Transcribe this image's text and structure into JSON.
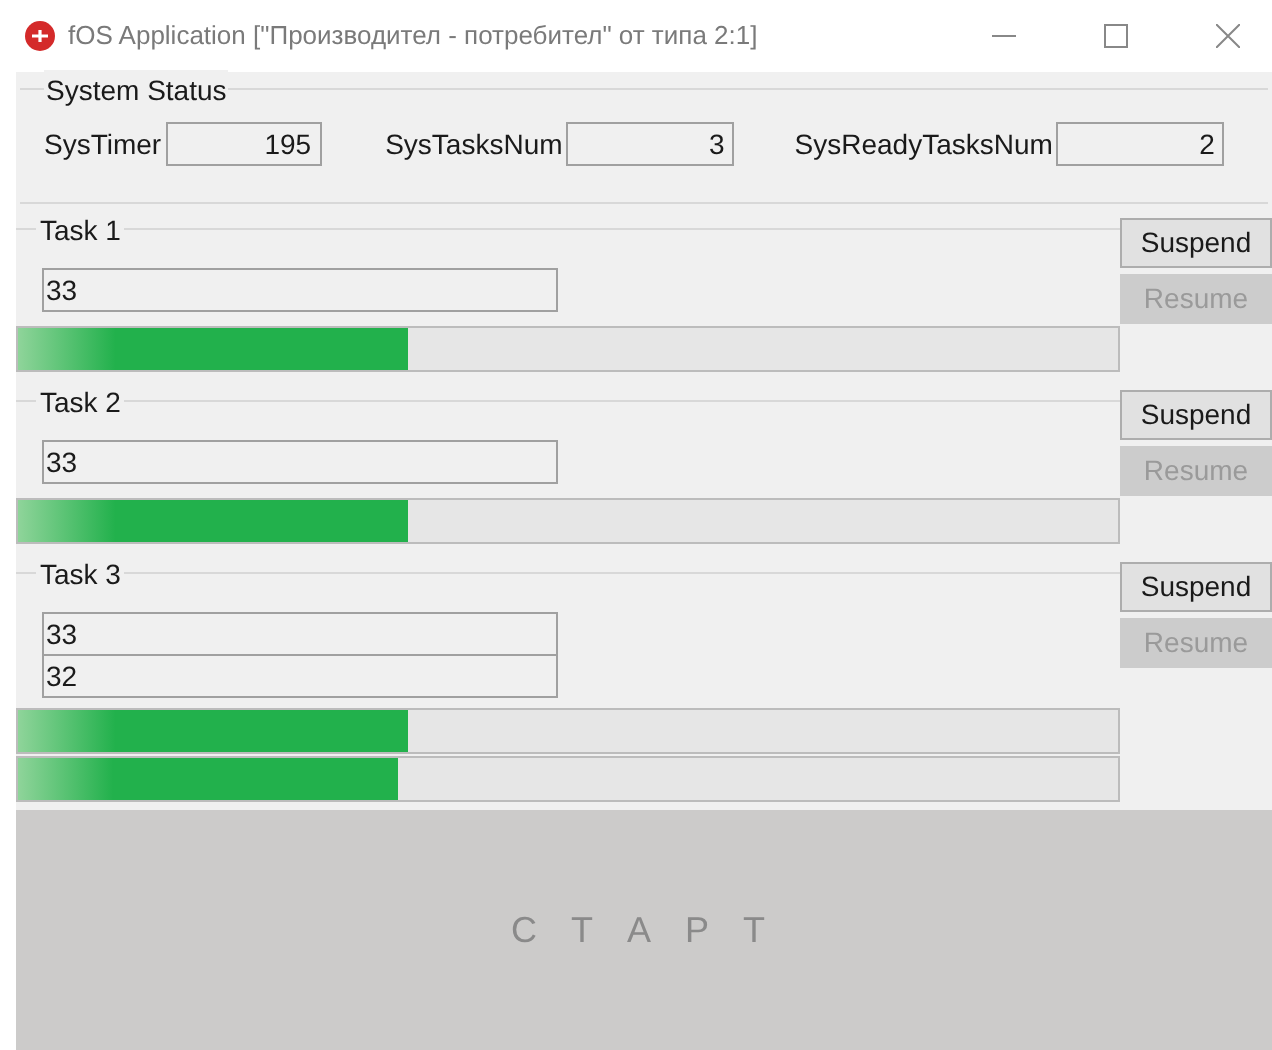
{
  "window": {
    "title": "fOS Application [\"Производител - потребител\" от типа 2:1]"
  },
  "system_status": {
    "title": "System Status",
    "fields": [
      {
        "label": "SysTimer",
        "value": "195"
      },
      {
        "label": "SysTasksNum",
        "value": "3"
      },
      {
        "label": "SysReadyTasksNum",
        "value": "2"
      }
    ]
  },
  "tasks": [
    {
      "title": "Task 1",
      "values": [
        "33"
      ],
      "bars": [
        {
          "level": 0.355
        }
      ],
      "suspend": {
        "label": "Suspend",
        "disabled": false
      },
      "resume": {
        "label": "Resume",
        "disabled": true
      }
    },
    {
      "title": "Task 2",
      "values": [
        "33"
      ],
      "bars": [
        {
          "level": 0.355
        }
      ],
      "suspend": {
        "label": "Suspend",
        "disabled": false
      },
      "resume": {
        "label": "Resume",
        "disabled": true
      }
    },
    {
      "title": "Task 3",
      "values": [
        "33",
        "32"
      ],
      "bars": [
        {
          "level": 0.355
        },
        {
          "level": 0.345
        }
      ],
      "suspend": {
        "label": "Suspend",
        "disabled": false
      },
      "resume": {
        "label": "Resume",
        "disabled": true
      }
    }
  ],
  "start_button": {
    "label": "С Т А Р Т"
  }
}
